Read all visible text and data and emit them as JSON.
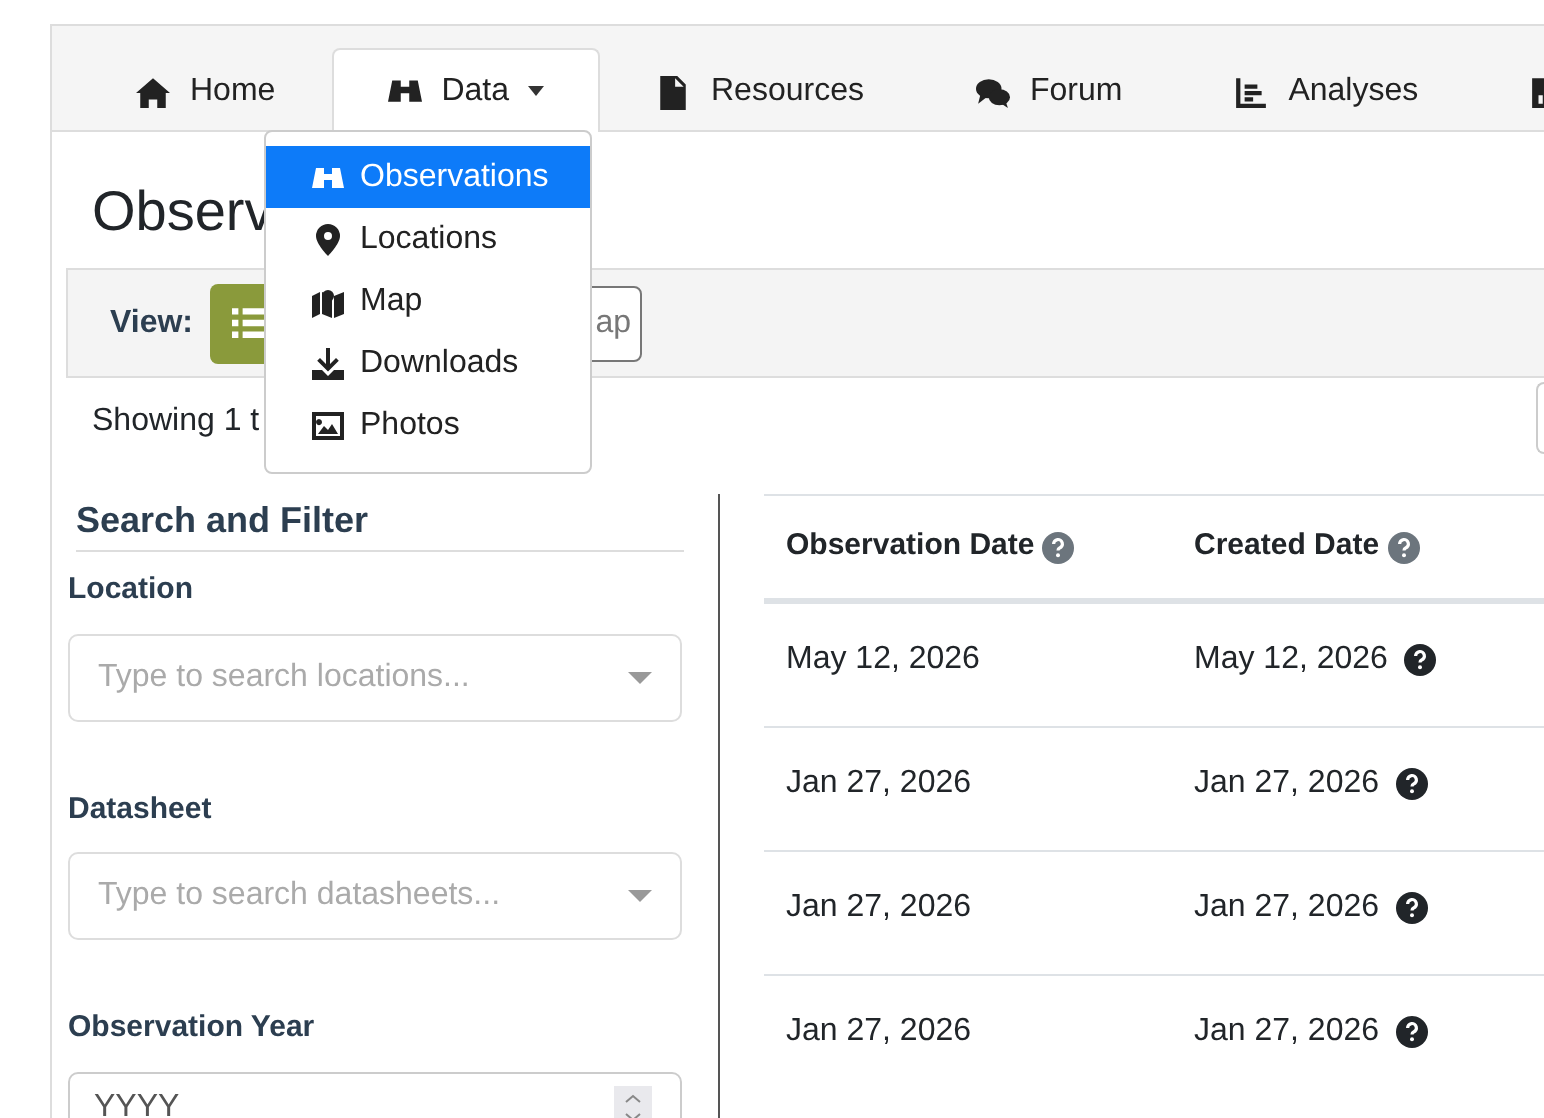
{
  "tabs": [
    {
      "label": "Home",
      "kind": "home",
      "selected": false,
      "caret": false
    },
    {
      "label": "Data",
      "kind": "binoculars",
      "selected": true,
      "caret": true
    },
    {
      "label": "Resources",
      "kind": "document",
      "selected": false,
      "caret": false
    },
    {
      "label": "Forum",
      "kind": "comments",
      "selected": false,
      "caret": false
    },
    {
      "label": "Analyses",
      "kind": "chart-lines",
      "selected": false,
      "caret": false
    },
    {
      "kind": "chart-square",
      "selected": false,
      "caret": false
    }
  ],
  "dropdown": [
    {
      "label": "Observations",
      "kind": "binoculars",
      "selected": true
    },
    {
      "label": "Locations",
      "kind": "pin",
      "selected": false
    },
    {
      "label": "Map",
      "kind": "map",
      "selected": false
    },
    {
      "label": "Downloads",
      "kind": "download",
      "selected": false
    },
    {
      "label": "Photos",
      "kind": "image",
      "selected": false
    }
  ],
  "heading": "Observ",
  "view": {
    "label": "View:",
    "buttons": [
      {
        "kind": "list",
        "selected": true
      },
      {
        "label": "ap",
        "selected": false
      }
    ]
  },
  "showing": "Showing 1 t",
  "filter": {
    "title": "Search and Filter",
    "fields": [
      {
        "label": "Location",
        "kind": "select",
        "placeholder": "Type to search locations..."
      },
      {
        "label": "Datasheet",
        "kind": "select",
        "placeholder": "Type to search datasheets..."
      },
      {
        "label": "Observation Year",
        "kind": "number",
        "placeholder": "YYYY"
      }
    ]
  },
  "table": {
    "columns": [
      "Observation Date",
      "Created Date"
    ],
    "rows": [
      [
        "May 12, 2026",
        "May 12, 2026"
      ],
      [
        "Jan 27, 2026",
        "Jan 27, 2026"
      ],
      [
        "Jan 27, 2026",
        "Jan 27, 2026"
      ],
      [
        "Jan 27, 2026",
        "Jan 27, 2026"
      ]
    ]
  }
}
